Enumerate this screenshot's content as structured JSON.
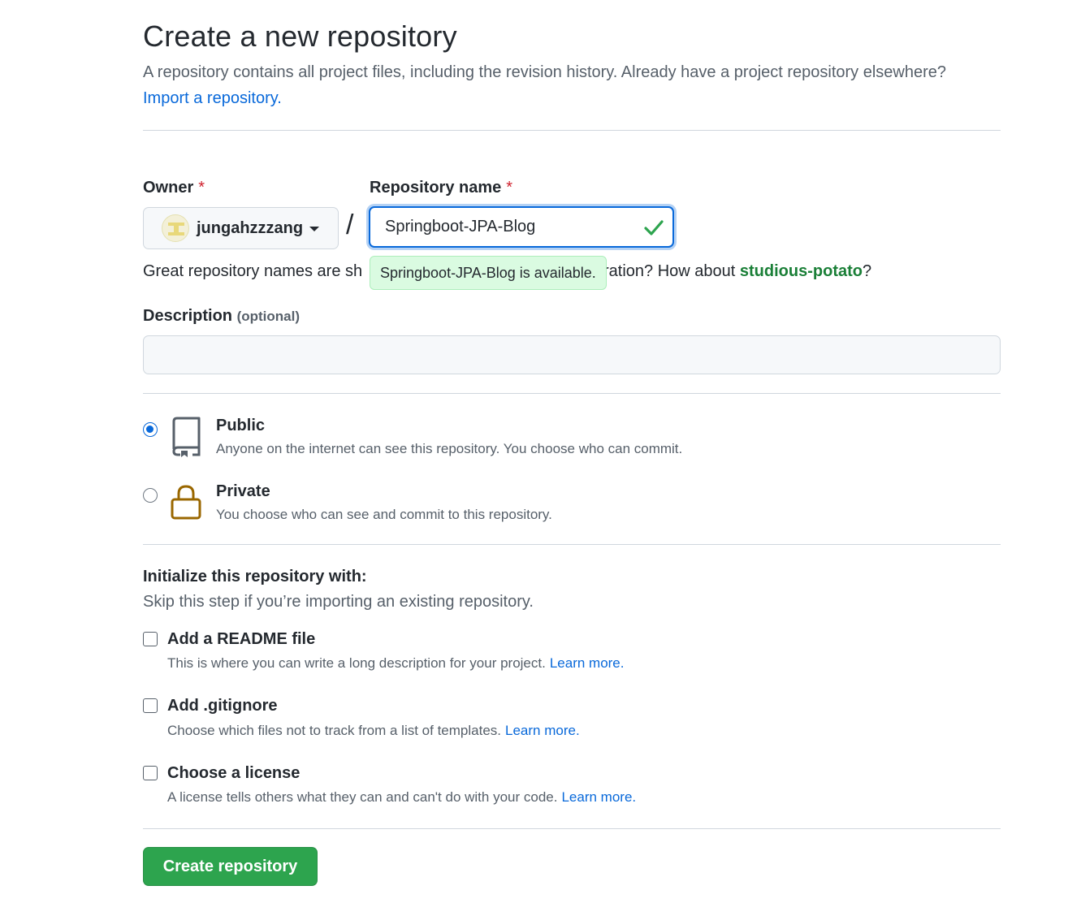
{
  "header": {
    "title": "Create a new repository",
    "subtitle": "A repository contains all project files, including the revision history. Already have a project repository elsewhere?",
    "import_link": "Import a repository."
  },
  "owner": {
    "label": "Owner",
    "required_mark": "*",
    "selected": "jungahzzzang"
  },
  "separator": "/",
  "repo_name": {
    "label": "Repository name",
    "required_mark": "*",
    "value": "Springboot-JPA-Blog",
    "availability": "Springboot-JPA-Blog is available.",
    "availability_color": "#dafbe1"
  },
  "name_hint": {
    "prefix": "Great repository names are sh",
    "suffix": "ration? How about ",
    "suggestion": "studious-potato",
    "end": "?"
  },
  "description": {
    "label": "Description",
    "optional": "(optional)",
    "value": ""
  },
  "visibility": [
    {
      "title": "Public",
      "desc": "Anyone on the internet can see this repository. You choose who can commit.",
      "icon": "repo-icon",
      "checked": true
    },
    {
      "title": "Private",
      "desc": "You choose who can see and commit to this repository.",
      "icon": "lock-icon",
      "checked": false
    }
  ],
  "initialize": {
    "title": "Initialize this repository with:",
    "subtitle": "Skip this step if you’re importing an existing repository.",
    "options": [
      {
        "title": "Add a README file",
        "desc": "This is where you can write a long description for your project.",
        "link": "Learn more."
      },
      {
        "title": "Add .gitignore",
        "desc": "Choose which files not to track from a list of templates.",
        "link": "Learn more."
      },
      {
        "title": "Choose a license",
        "desc": "A license tells others what they can and can't do with your code.",
        "link": "Learn more."
      }
    ]
  },
  "submit": {
    "label": "Create repository",
    "color": "#2da44e"
  },
  "colors": {
    "link": "#0969da",
    "success_text": "#1a7f37",
    "lock_icon": "#9a6700",
    "required": "#cf222e"
  }
}
